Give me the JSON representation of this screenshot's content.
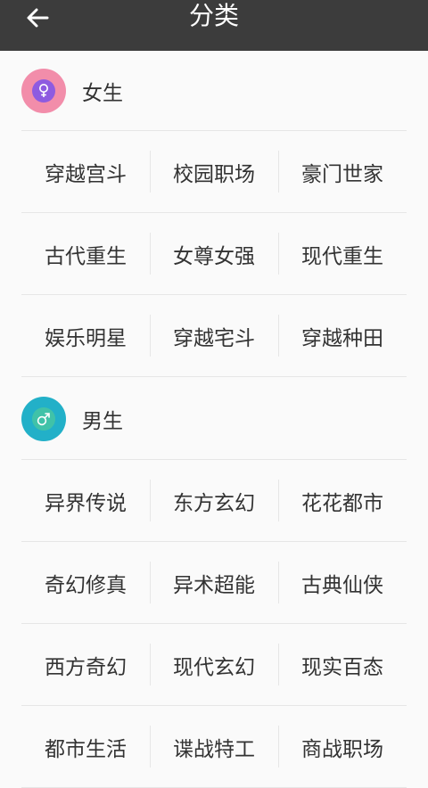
{
  "header": {
    "title": "分类"
  },
  "colors": {
    "appbar": "#3c3c3c",
    "female_accent": "#f28daa",
    "female_inner": "#8e5be0",
    "male_accent": "#22b0c8",
    "male_inner": "#40c2a8"
  },
  "female": {
    "title": "女生",
    "icon": "female-symbol-icon",
    "rows": [
      [
        "穿越宫斗",
        "校园职场",
        "豪门世家"
      ],
      [
        "古代重生",
        "女尊女强",
        "现代重生"
      ],
      [
        "娱乐明星",
        "穿越宅斗",
        "穿越种田"
      ]
    ]
  },
  "male": {
    "title": "男生",
    "icon": "male-symbol-icon",
    "rows": [
      [
        "异界传说",
        "东方玄幻",
        "花花都市"
      ],
      [
        "奇幻修真",
        "异术超能",
        "古典仙侠"
      ],
      [
        "西方奇幻",
        "现代玄幻",
        "现实百态"
      ],
      [
        "都市生活",
        "谍战特工",
        "商战职场"
      ]
    ]
  }
}
